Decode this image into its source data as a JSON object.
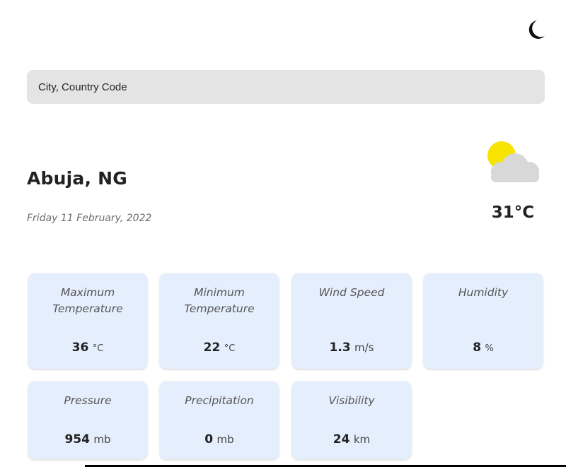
{
  "theme_toggle": {
    "icon": "moon-icon"
  },
  "search": {
    "placeholder": "City, Country Code",
    "value": ""
  },
  "location": {
    "city": "Abuja, NG",
    "date": "Friday 11 February, 2022"
  },
  "current": {
    "icon": "partly-cloudy-icon",
    "temperature": "31°C"
  },
  "stats": [
    {
      "label": "Maximum Temperature",
      "value": "36",
      "unit": "°C"
    },
    {
      "label": "Minimum Temperature",
      "value": "22",
      "unit": "°C"
    },
    {
      "label": "Wind Speed",
      "value": "1.3",
      "unit": "m/s"
    },
    {
      "label": "Humidity",
      "value": "8",
      "unit": "%"
    },
    {
      "label": "Pressure",
      "value": "954",
      "unit": "mb"
    },
    {
      "label": "Precipitation",
      "value": "0",
      "unit": "mb"
    },
    {
      "label": "Visibility",
      "value": "24",
      "unit": "km"
    }
  ],
  "colors": {
    "card_bg": "#e5eefc",
    "sun": "#f7e400",
    "cloud": "#d8d8d8",
    "search_bg": "#e4e4e4"
  }
}
